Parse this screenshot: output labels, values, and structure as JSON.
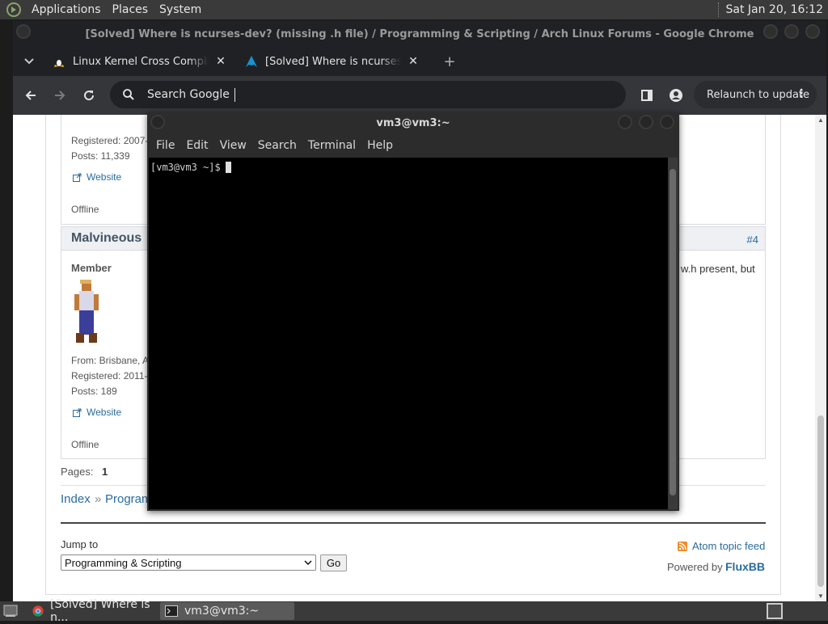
{
  "top_panel": {
    "menus": [
      "Applications",
      "Places",
      "System"
    ],
    "clock": "Sat Jan 20, 16:12"
  },
  "chrome": {
    "window_title": "[Solved] Where is ncurses-dev? (missing .h file) / Programming & Scripting / Arch Linux Forums - Google Chrome",
    "tabs": [
      {
        "title": "Linux Kernel Cross Compilation",
        "favicon": "penguin-icon"
      },
      {
        "title": "[Solved] Where is ncurses-dev? (missing .h file)",
        "favicon": "arch-linux-icon"
      }
    ],
    "omnibox_placeholder": "Search Google",
    "relaunch_label": "Relaunch to update"
  },
  "page": {
    "prev_post": {
      "registered": "Registered: 2007-",
      "posts": "Posts: 11,339",
      "website": "Website",
      "status": "Offline"
    },
    "post": {
      "author": "Malvineous",
      "number": "#4",
      "title": "Member",
      "from": "From: Brisbane, A",
      "registered": "Registered: 2011-",
      "posts": "Posts: 189",
      "website": "Website",
      "status": "Offline",
      "text_fragment": "w.h present, but"
    },
    "pages_label": "Pages:",
    "pages_current": "1",
    "breadcrumb_index": "Index",
    "breadcrumb_sep": "»",
    "breadcrumb_section": "Program",
    "jump_to_label": "Jump to",
    "jump_select_value": "Programming & Scripting",
    "go_button": "Go",
    "atom_feed": "Atom topic feed",
    "powered_by": "Powered by",
    "fluxbb": "FluxBB"
  },
  "terminal": {
    "title": "vm3@vm3:~",
    "menus": [
      "File",
      "Edit",
      "View",
      "Search",
      "Terminal",
      "Help"
    ],
    "prompt": "[vm3@vm3 ~]$"
  },
  "taskbar": {
    "items": [
      {
        "label": "[Solved] Where is n...",
        "icon": "chrome-icon"
      },
      {
        "label": "vm3@vm3:~",
        "icon": "terminal-icon"
      }
    ]
  },
  "colors": {
    "link": "#2a6b9e",
    "panel": "#3a3a3a",
    "chrome_toolbar": "#35363a"
  }
}
